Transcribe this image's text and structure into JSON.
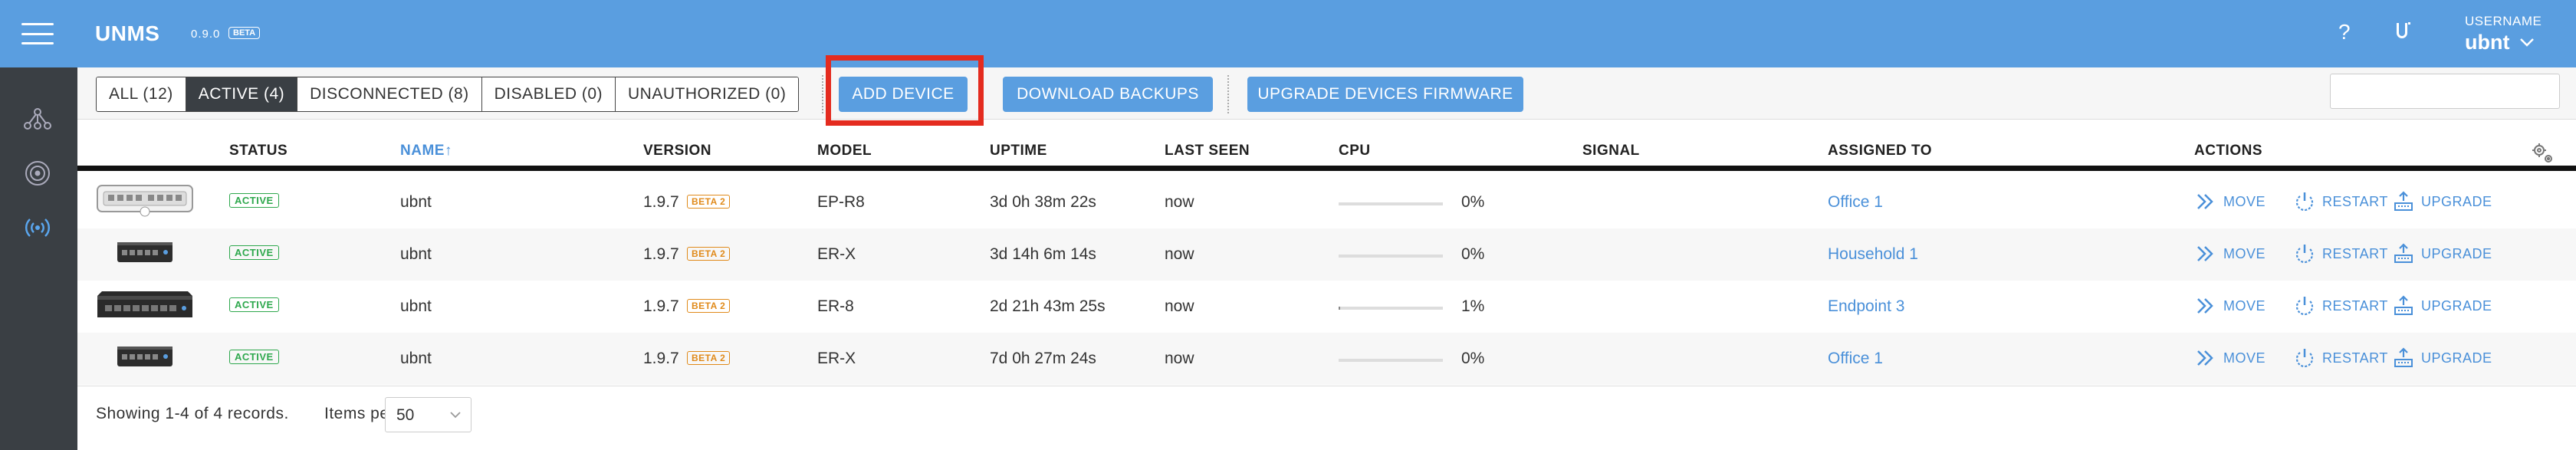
{
  "header": {
    "app_name": "UNMS",
    "version": "0.9.0",
    "beta_label": "BETA",
    "help_label": "?",
    "username_label": "USERNAME",
    "username": "ubnt"
  },
  "toolbar": {
    "filters": [
      {
        "label": "ALL (12)",
        "active": false
      },
      {
        "label": "ACTIVE (4)",
        "active": true
      },
      {
        "label": "DISCONNECTED (8)",
        "active": false
      },
      {
        "label": "DISABLED (0)",
        "active": false
      },
      {
        "label": "UNAUTHORIZED (0)",
        "active": false
      }
    ],
    "add_device": "ADD DEVICE",
    "download_backups": "DOWNLOAD BACKUPS",
    "upgrade_firmware": "UPGRADE DEVICES FIRMWARE",
    "search_value": ""
  },
  "table": {
    "columns": {
      "status": "STATUS",
      "name": "NAME",
      "sort_arrow": "↑",
      "version": "VERSION",
      "model": "MODEL",
      "uptime": "UPTIME",
      "last_seen": "LAST SEEN",
      "cpu": "CPU",
      "signal": "SIGNAL",
      "assigned_to": "ASSIGNED TO",
      "actions": "ACTIONS"
    },
    "rows": [
      {
        "status": "ACTIVE",
        "name": "ubnt",
        "version": "1.9.7",
        "beta": "BETA 2",
        "model": "EP-R8",
        "uptime": "3d 0h 38m 22s",
        "last_seen": "now",
        "cpu": "0%",
        "cpu_fraction": 0.0,
        "assigned_to": "Office 1",
        "move": "MOVE",
        "restart": "RESTART",
        "upgrade": "UPGRADE",
        "device_icon": "ep-r8-router-icon"
      },
      {
        "status": "ACTIVE",
        "name": "ubnt",
        "version": "1.9.7",
        "beta": "BETA 2",
        "model": "ER-X",
        "uptime": "3d 14h 6m 14s",
        "last_seen": "now",
        "cpu": "0%",
        "cpu_fraction": 0.0,
        "assigned_to": "Household 1",
        "move": "MOVE",
        "restart": "RESTART",
        "upgrade": "UPGRADE",
        "device_icon": "er-x-router-icon"
      },
      {
        "status": "ACTIVE",
        "name": "ubnt",
        "version": "1.9.7",
        "beta": "BETA 2",
        "model": "ER-8",
        "uptime": "2d 21h 43m 25s",
        "last_seen": "now",
        "cpu": "1%",
        "cpu_fraction": 0.01,
        "assigned_to": "Endpoint 3",
        "move": "MOVE",
        "restart": "RESTART",
        "upgrade": "UPGRADE",
        "device_icon": "er-8-router-icon"
      },
      {
        "status": "ACTIVE",
        "name": "ubnt",
        "version": "1.9.7",
        "beta": "BETA 2",
        "model": "ER-X",
        "uptime": "7d 0h 27m 24s",
        "last_seen": "now",
        "cpu": "0%",
        "cpu_fraction": 0.0,
        "assigned_to": "Office 1",
        "move": "MOVE",
        "restart": "RESTART",
        "upgrade": "UPGRADE",
        "device_icon": "er-x-router-icon"
      }
    ]
  },
  "footer": {
    "records": "Showing 1-4 of 4 records.",
    "items_per_page_label": "Items per page:",
    "items_per_page_value": "50"
  },
  "colors": {
    "header_bg": "#5a9ee0",
    "sidebar_bg": "#3a3f44",
    "link": "#4a90d9",
    "active_status": "#2ea84d",
    "beta": "#e08a1a",
    "highlight": "#e42b1f"
  }
}
